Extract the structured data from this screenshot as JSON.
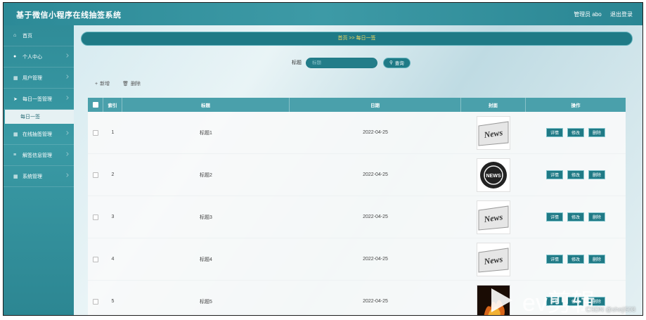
{
  "app": {
    "title": "基于微信小程序在线抽签系统",
    "user_label": "管理员 abo",
    "logout_label": "退出登录"
  },
  "sidebar": {
    "items": [
      {
        "icon": "home-icon",
        "label": "首页"
      },
      {
        "icon": "user-icon",
        "label": "个人中心"
      },
      {
        "icon": "building-icon",
        "label": "用户管理"
      },
      {
        "icon": "send-icon",
        "label": "每日一签管理"
      },
      {
        "icon": "grid-icon",
        "label": "在线抽签管理"
      },
      {
        "icon": "list-icon",
        "label": "解签信息管理"
      },
      {
        "icon": "grid-icon",
        "label": "系统管理"
      }
    ],
    "sub_item": "每日一签"
  },
  "breadcrumb": "首页 >> 每日一签",
  "search": {
    "label": "标题",
    "placeholder": "标题",
    "button": "查询"
  },
  "actions": {
    "add": "新增",
    "delete": "删除"
  },
  "table": {
    "headers": [
      "索引",
      "标题",
      "日期",
      "封面",
      "操作"
    ],
    "rows": [
      {
        "index": "1",
        "title": "标题1",
        "date": "2022-04-25",
        "cover": "news-paper"
      },
      {
        "index": "2",
        "title": "标题2",
        "date": "2022-04-25",
        "cover": "news-globe"
      },
      {
        "index": "3",
        "title": "标题3",
        "date": "2022-04-25",
        "cover": "news-paper"
      },
      {
        "index": "4",
        "title": "标题4",
        "date": "2022-04-25",
        "cover": "news-paper"
      },
      {
        "index": "5",
        "title": "标题5",
        "date": "2022-04-25",
        "cover": "fire"
      }
    ],
    "ops": {
      "detail": "详情",
      "edit": "修改",
      "delete": "删除"
    }
  },
  "cover_text": "News",
  "cover_globe_text": "NEWS",
  "overlay": {
    "ev_text": "ev剪辑",
    "watermark": "CSDN @sheji508"
  },
  "colors": {
    "accent": "#1f7a86",
    "sidebar": "#3a9aa5",
    "breadcrumb_text": "#f0d860"
  }
}
